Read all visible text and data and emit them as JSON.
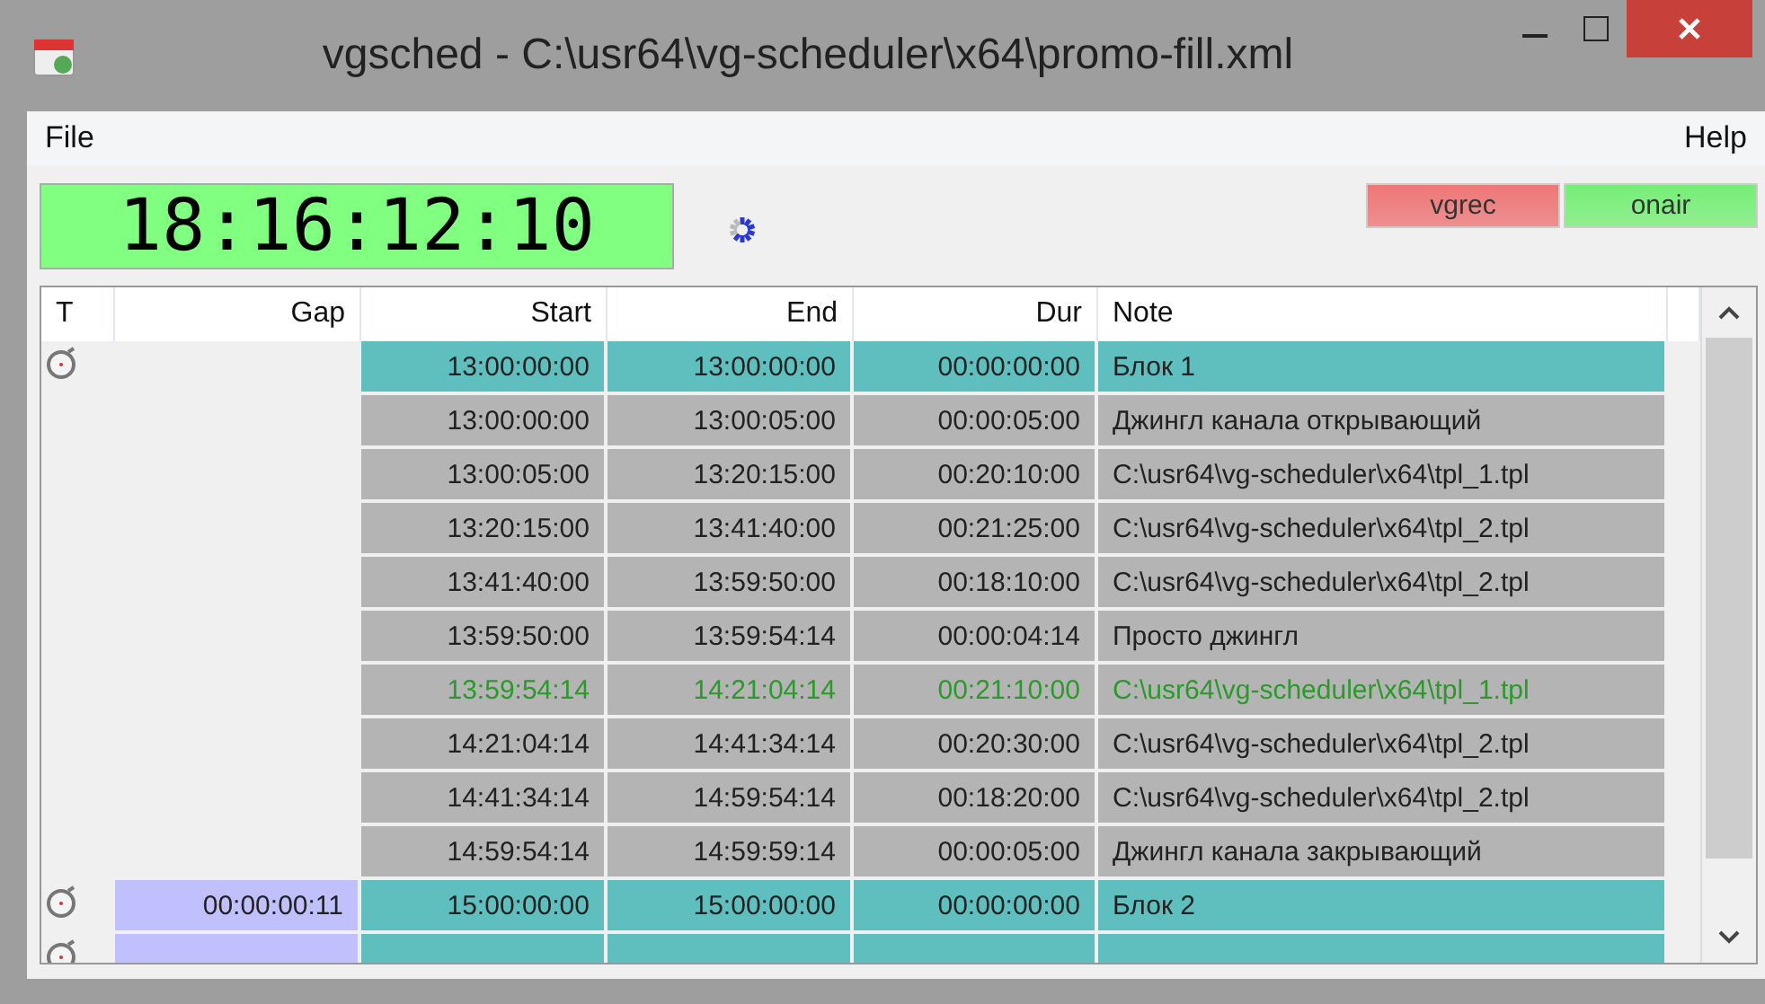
{
  "window": {
    "title": "vgsched - C:\\usr64\\vg-scheduler\\x64\\promo-fill.xml"
  },
  "menu": {
    "left": "File",
    "right": "Help"
  },
  "clock": "18:16:12:10",
  "indicators": [
    {
      "label": "vgrec",
      "color": "#ee7777"
    },
    {
      "label": "onair",
      "color": "#77ee77"
    }
  ],
  "table": {
    "columns": [
      "T",
      "Gap",
      "Start",
      "End",
      "Dur",
      "Note"
    ],
    "rows": [
      {
        "kind": "block",
        "active": false,
        "start": "13:00:00:00",
        "end": "13:00:00:00",
        "dur": "00:00:00:00",
        "note": "Блок 1"
      },
      {
        "kind": "item",
        "active": false,
        "start": "13:00:00:00",
        "end": "13:00:05:00",
        "dur": "00:00:05:00",
        "note": "Джингл канала открывающий"
      },
      {
        "kind": "item",
        "active": false,
        "start": "13:00:05:00",
        "end": "13:20:15:00",
        "dur": "00:20:10:00",
        "note": "C:\\usr64\\vg-scheduler\\x64\\tpl_1.tpl"
      },
      {
        "kind": "item",
        "active": false,
        "start": "13:20:15:00",
        "end": "13:41:40:00",
        "dur": "00:21:25:00",
        "note": "C:\\usr64\\vg-scheduler\\x64\\tpl_2.tpl"
      },
      {
        "kind": "item",
        "active": false,
        "start": "13:41:40:00",
        "end": "13:59:50:00",
        "dur": "00:18:10:00",
        "note": "C:\\usr64\\vg-scheduler\\x64\\tpl_2.tpl"
      },
      {
        "kind": "item",
        "active": false,
        "start": "13:59:50:00",
        "end": "13:59:54:14",
        "dur": "00:00:04:14",
        "note": "Просто джингл"
      },
      {
        "kind": "item",
        "active": true,
        "start": "13:59:54:14",
        "end": "14:21:04:14",
        "dur": "00:21:10:00",
        "note": "C:\\usr64\\vg-scheduler\\x64\\tpl_1.tpl"
      },
      {
        "kind": "item",
        "active": false,
        "start": "14:21:04:14",
        "end": "14:41:34:14",
        "dur": "00:20:30:00",
        "note": "C:\\usr64\\vg-scheduler\\x64\\tpl_2.tpl"
      },
      {
        "kind": "item",
        "active": false,
        "start": "14:41:34:14",
        "end": "14:59:54:14",
        "dur": "00:18:20:00",
        "note": "C:\\usr64\\vg-scheduler\\x64\\tpl_2.tpl"
      },
      {
        "kind": "item",
        "active": false,
        "start": "14:59:54:14",
        "end": "14:59:59:14",
        "dur": "00:00:05:00",
        "note": "Джингл канала закрывающий"
      },
      {
        "kind": "block",
        "active": false,
        "gap": "00:00:00:11",
        "start": "15:00:00:00",
        "end": "15:00:00:00",
        "dur": "00:00:00:00",
        "note": "Блок 2"
      },
      {
        "kind": "block",
        "gap_shown": true
      }
    ]
  }
}
